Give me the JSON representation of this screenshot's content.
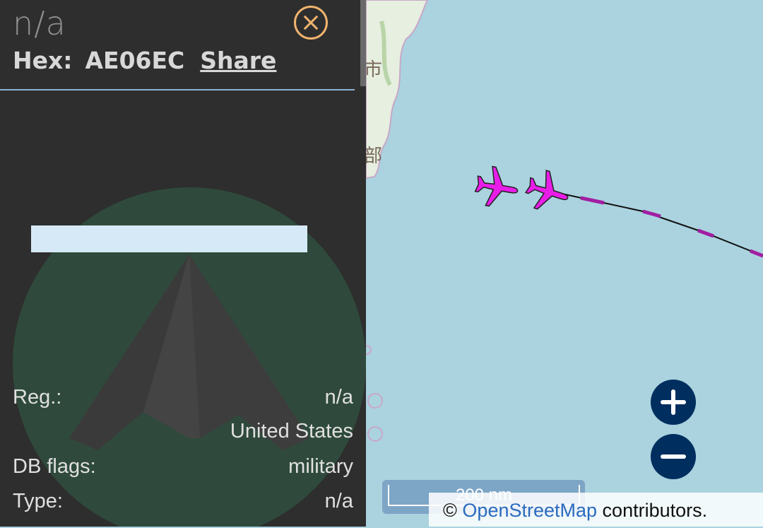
{
  "panel": {
    "title": "n/a",
    "hex_label": "Hex:",
    "hex_value": "AE06EC",
    "share_label": "Share",
    "rows": [
      {
        "label": "Reg.:",
        "value": "n/a"
      },
      {
        "label": "",
        "value": "United States"
      },
      {
        "label": "DB flags:",
        "value": "military"
      },
      {
        "label": "Type:",
        "value": "n/a"
      }
    ],
    "icons": {
      "close": "close-icon",
      "logo": "adsb-logo"
    },
    "colors": {
      "background": "#2e2e2e",
      "close_accent": "#f0b36e",
      "divider": "#8ab4d8"
    }
  },
  "map": {
    "labels": [
      "市",
      "部"
    ],
    "scale_label": "200 nm",
    "attribution_prefix": "©",
    "attribution_link": "OpenStreetMap",
    "attribution_suffix": "contributors.",
    "aircraft_color": "#e81ee8",
    "water_color": "#aad3df",
    "land_color": "#e6efe0",
    "zoom_in_icon": "plus-icon",
    "zoom_out_icon": "minus-icon",
    "aircraft_icon": "airplane-icon"
  }
}
